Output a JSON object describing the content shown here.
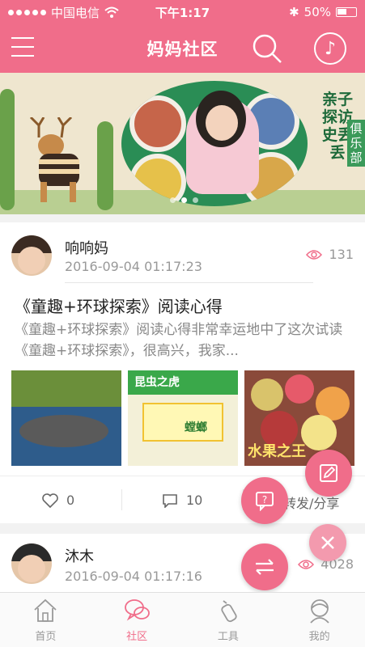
{
  "status_bar": {
    "carrier": "中国电信",
    "time": "下午1:17",
    "battery": "50%"
  },
  "header": {
    "title": "妈妈社区"
  },
  "banner": {
    "text_main": "亲子探访史丢丢",
    "text_sub": "俱乐部",
    "active_slide": 2,
    "slide_count": 3
  },
  "posts": [
    {
      "author": "响响妈",
      "datetime": "2016-09-04 01:17:23",
      "views": "131",
      "title": "《童趣+环球探索》阅读心得",
      "excerpt": "《童趣+环球探索》阅读心得非常幸运地中了这次试读《童趣+环球探索》，很高兴，我家...",
      "thumb_labels": [
        "昆虫之虎",
        "螳螂",
        "水果之王"
      ],
      "likes": "0",
      "comments": "10",
      "share_label": "转发/分享"
    },
    {
      "author": "沐木",
      "datetime": "2016-09-04 01:17:16",
      "views": "4028"
    }
  ],
  "tabs": [
    {
      "label": "首页",
      "icon": "home-icon"
    },
    {
      "label": "社区",
      "icon": "community-icon",
      "active": true
    },
    {
      "label": "工具",
      "icon": "bottle-icon"
    },
    {
      "label": "我的",
      "icon": "profile-icon"
    }
  ],
  "colors": {
    "accent": "#f06d8a",
    "accent_light": "#f39aae"
  }
}
